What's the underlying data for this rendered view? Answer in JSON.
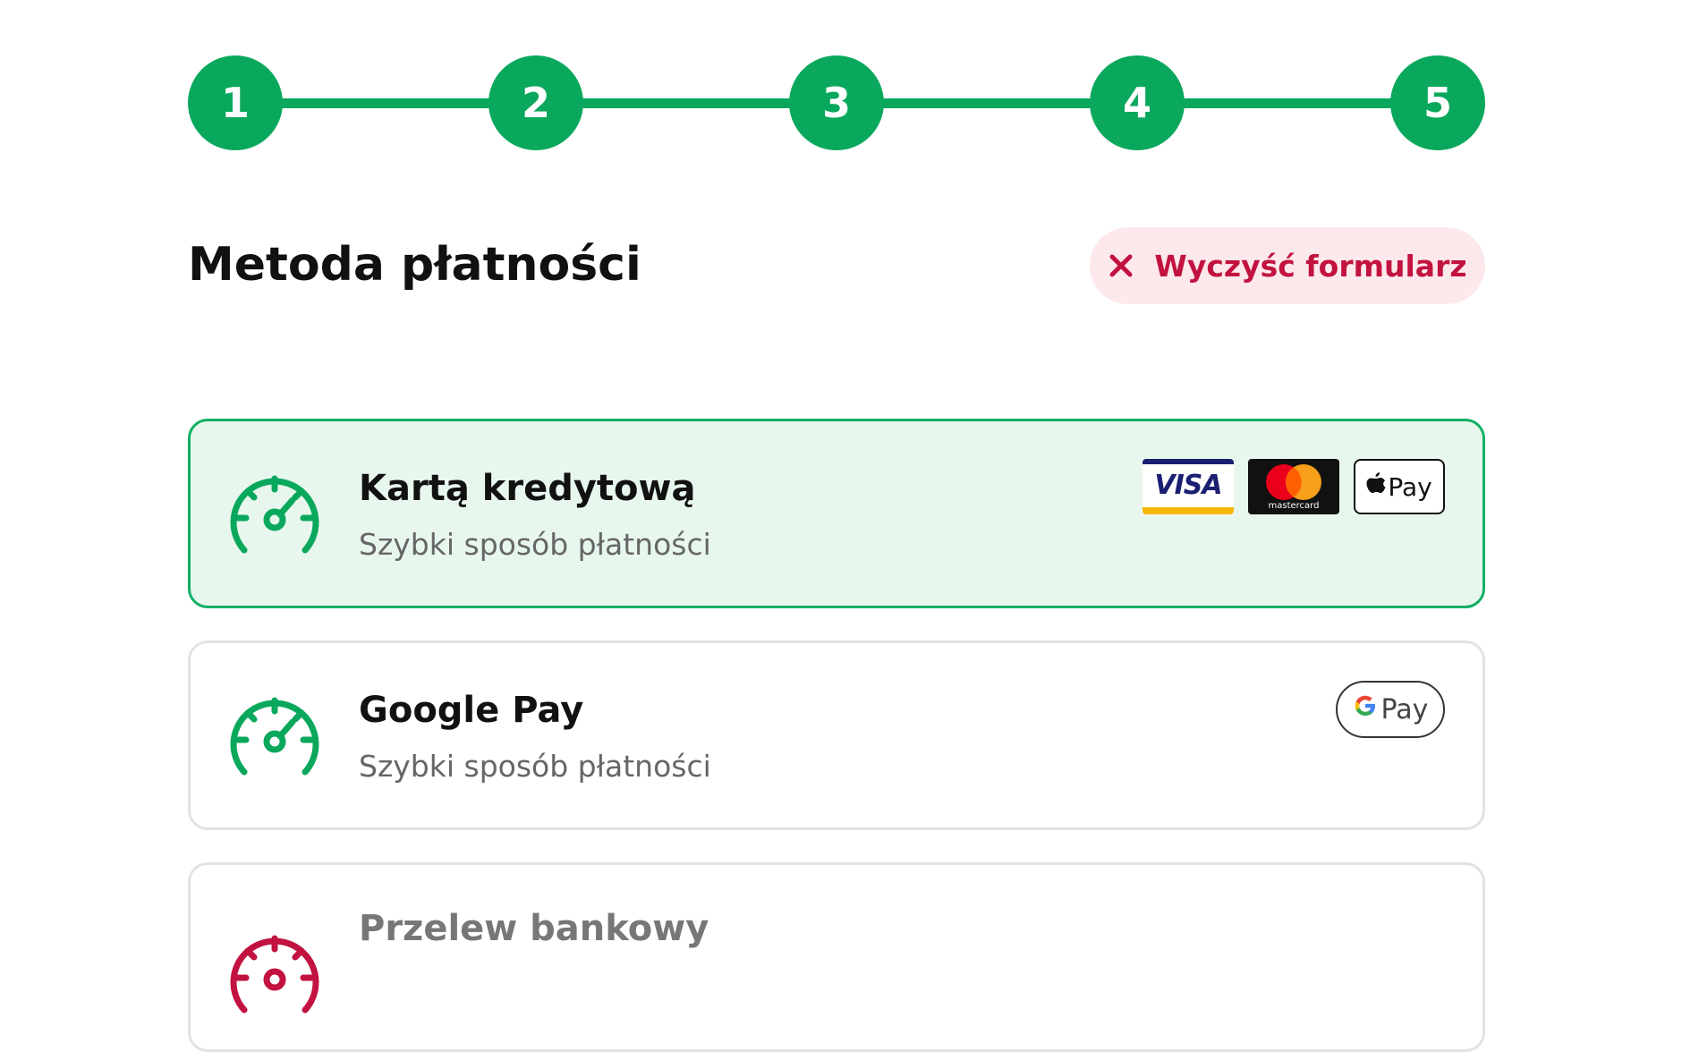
{
  "stepper": {
    "steps": [
      "1",
      "2",
      "3",
      "4",
      "5"
    ]
  },
  "header": {
    "title": "Metoda płatności",
    "clear_label": "Wyczyść formularz"
  },
  "methods": [
    {
      "title": "Kartą kredytową",
      "subtitle": "Szybki sposób płatności",
      "selected": true,
      "logos": [
        "VISA",
        "mastercard",
        "Pay"
      ]
    },
    {
      "title": "Google Pay",
      "subtitle": "Szybki sposób płatności",
      "selected": false,
      "logos": [
        "Pay"
      ]
    },
    {
      "title": "Przelew bankowy",
      "selected": false
    }
  ],
  "colors": {
    "accent": "#0aa85c",
    "danger": "#c2123f",
    "danger_bg": "#fde8ec",
    "selected_bg": "#e8f7ee"
  },
  "icons": {
    "method": "speedometer-icon",
    "clear": "close-icon"
  }
}
